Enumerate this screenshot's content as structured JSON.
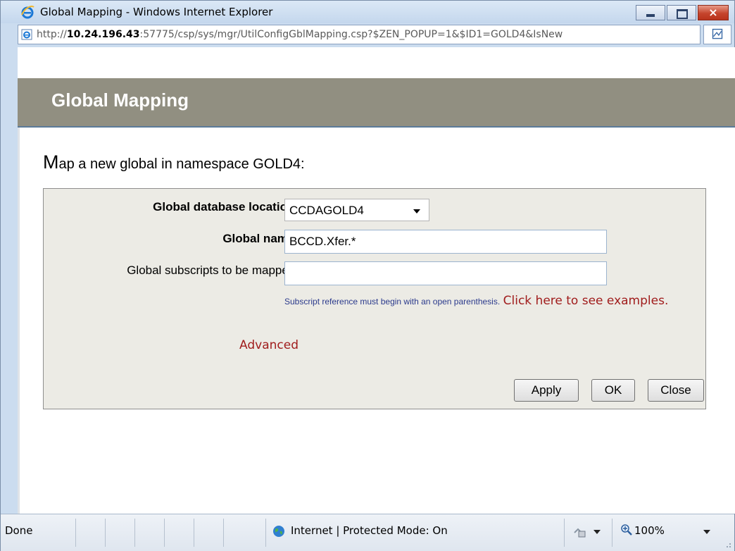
{
  "window": {
    "title": "Global Mapping - Windows Internet Explorer",
    "url_prefix": "http://",
    "url_host": "10.24.196.43",
    "url_rest": ":57775/csp/sys/mgr/UtilConfigGblMapping.csp?$ZEN_POPUP=1&$ID1=GOLD4&IsNew",
    "buttons": {
      "minimize": "minimize-icon",
      "maximize": "maximize-icon",
      "close": "×"
    }
  },
  "page": {
    "header_title": "Global Mapping",
    "intro_first_letter": "M",
    "intro_rest": "ap a new global in namespace GOLD4:"
  },
  "form": {
    "db_location_label": "Global database location:",
    "db_location_value": "CCDAGOLD4",
    "global_name_label": "Global name:",
    "global_name_value": "BCCD.Xfer.*",
    "subscripts_label": "Global subscripts to be mapped:",
    "subscripts_value": "",
    "hint_text": "Subscript reference must begin with an open parenthesis.",
    "hint_link": "Click here to see examples.",
    "advanced_link": "Advanced",
    "apply_label": "Apply",
    "ok_label": "OK",
    "close_label": "Close"
  },
  "status": {
    "text": "Done",
    "zone": "Internet | Protected Mode: On",
    "zoom": "100%"
  },
  "colors": {
    "header_band": "#918f81",
    "link": "#a01c1c",
    "hint": "#2b3a8c",
    "form_bg": "#ecebe5"
  }
}
